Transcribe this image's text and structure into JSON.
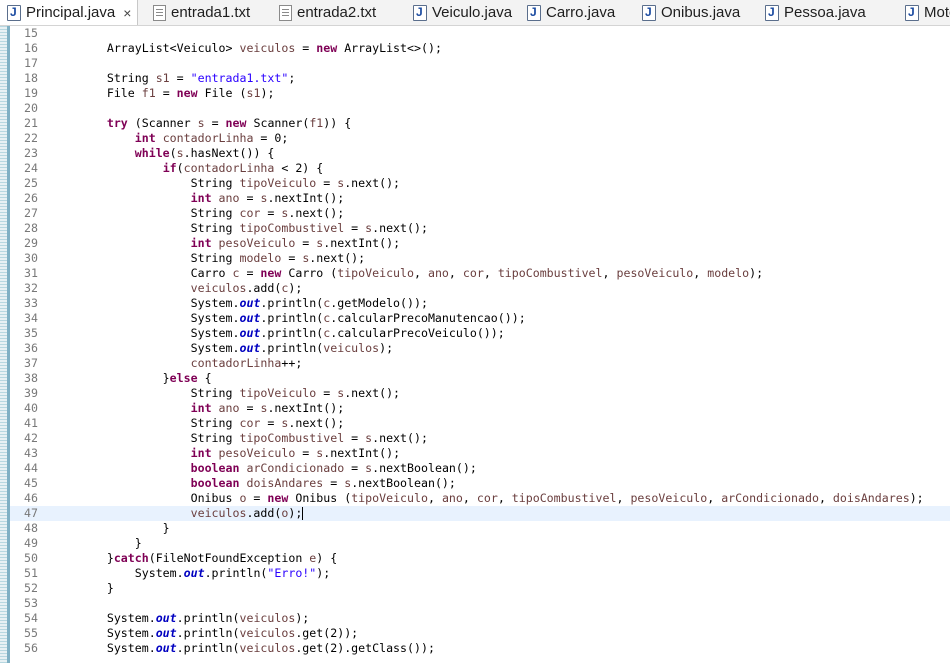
{
  "tabs": [
    {
      "label": "Principal.java",
      "type": "java",
      "active": true,
      "close": "×",
      "icon": "java-class-icon"
    },
    {
      "label": "entrada1.txt",
      "type": "txt",
      "icon": "text-file-icon"
    },
    {
      "label": "entrada2.txt",
      "type": "txt",
      "icon": "text-file-icon"
    },
    {
      "label": "Veiculo.java",
      "type": "java",
      "icon": "java-class-icon"
    },
    {
      "label": "Carro.java",
      "type": "java",
      "icon": "java-class-icon"
    },
    {
      "label": "Onibus.java",
      "type": "java",
      "icon": "java-class-icon"
    },
    {
      "label": "Pessoa.java",
      "type": "java",
      "icon": "java-class-icon"
    },
    {
      "label": "Moto",
      "type": "java",
      "icon": "java-class-icon"
    }
  ],
  "editor": {
    "current_line": 47,
    "lines": [
      {
        "n": "15",
        "t": ""
      },
      {
        "n": "16",
        "t": "        ArrayList<Veiculo> veiculos = new ArrayList<>();"
      },
      {
        "n": "17",
        "t": ""
      },
      {
        "n": "18",
        "t": "        String s1 = \"entrada1.txt\";"
      },
      {
        "n": "19",
        "t": "        File f1 = new File (s1);"
      },
      {
        "n": "20",
        "t": ""
      },
      {
        "n": "21",
        "t": "        try (Scanner s = new Scanner(f1)) {"
      },
      {
        "n": "22",
        "t": "            int contadorLinha = 0;"
      },
      {
        "n": "23",
        "t": "            while(s.hasNext()) {"
      },
      {
        "n": "24",
        "t": "                if(contadorLinha < 2) {"
      },
      {
        "n": "25",
        "t": "                    String tipoVeiculo = s.next();"
      },
      {
        "n": "26",
        "t": "                    int ano = s.nextInt();"
      },
      {
        "n": "27",
        "t": "                    String cor = s.next();"
      },
      {
        "n": "28",
        "t": "                    String tipoCombustivel = s.next();"
      },
      {
        "n": "29",
        "t": "                    int pesoVeiculo = s.nextInt();"
      },
      {
        "n": "30",
        "t": "                    String modelo = s.next();"
      },
      {
        "n": "31",
        "t": "                    Carro c = new Carro (tipoVeiculo, ano, cor, tipoCombustivel, pesoVeiculo, modelo);"
      },
      {
        "n": "32",
        "t": "                    veiculos.add(c);"
      },
      {
        "n": "33",
        "t": "                    System.out.println(c.getModelo());"
      },
      {
        "n": "34",
        "t": "                    System.out.println(c.calcularPrecoManutencao());"
      },
      {
        "n": "35",
        "t": "                    System.out.println(c.calcularPrecoVeiculo());"
      },
      {
        "n": "36",
        "t": "                    System.out.println(veiculos);"
      },
      {
        "n": "37",
        "t": "                    contadorLinha++;"
      },
      {
        "n": "38",
        "t": "                }else {"
      },
      {
        "n": "39",
        "t": "                    String tipoVeiculo = s.next();"
      },
      {
        "n": "40",
        "t": "                    int ano = s.nextInt();"
      },
      {
        "n": "41",
        "t": "                    String cor = s.next();"
      },
      {
        "n": "42",
        "t": "                    String tipoCombustivel = s.next();"
      },
      {
        "n": "43",
        "t": "                    int pesoVeiculo = s.nextInt();"
      },
      {
        "n": "44",
        "t": "                    boolean arCondicionado = s.nextBoolean();"
      },
      {
        "n": "45",
        "t": "                    boolean doisAndares = s.nextBoolean();"
      },
      {
        "n": "46",
        "t": "                    Onibus o = new Onibus (tipoVeiculo, ano, cor, tipoCombustivel, pesoVeiculo, arCondicionado, doisAndares);"
      },
      {
        "n": "47",
        "t": "                    veiculos.add(o);"
      },
      {
        "n": "48",
        "t": "                }"
      },
      {
        "n": "49",
        "t": "            }"
      },
      {
        "n": "50",
        "t": "        }catch(FileNotFoundException e) {"
      },
      {
        "n": "51",
        "t": "            System.out.println(\"Erro!\");"
      },
      {
        "n": "52",
        "t": "        }"
      },
      {
        "n": "53",
        "t": ""
      },
      {
        "n": "54",
        "t": "        System.out.println(veiculos);"
      },
      {
        "n": "55",
        "t": "        System.out.println(veiculos.get(2));"
      },
      {
        "n": "56",
        "t": "        System.out.println(veiculos.get(2).getClass());"
      }
    ]
  },
  "colors": {
    "keyword": "#7f0055",
    "string": "#2a00ff",
    "static_field": "#0000c0",
    "local_variable": "#6a3e3e",
    "current_line": "#e8f2fe"
  }
}
